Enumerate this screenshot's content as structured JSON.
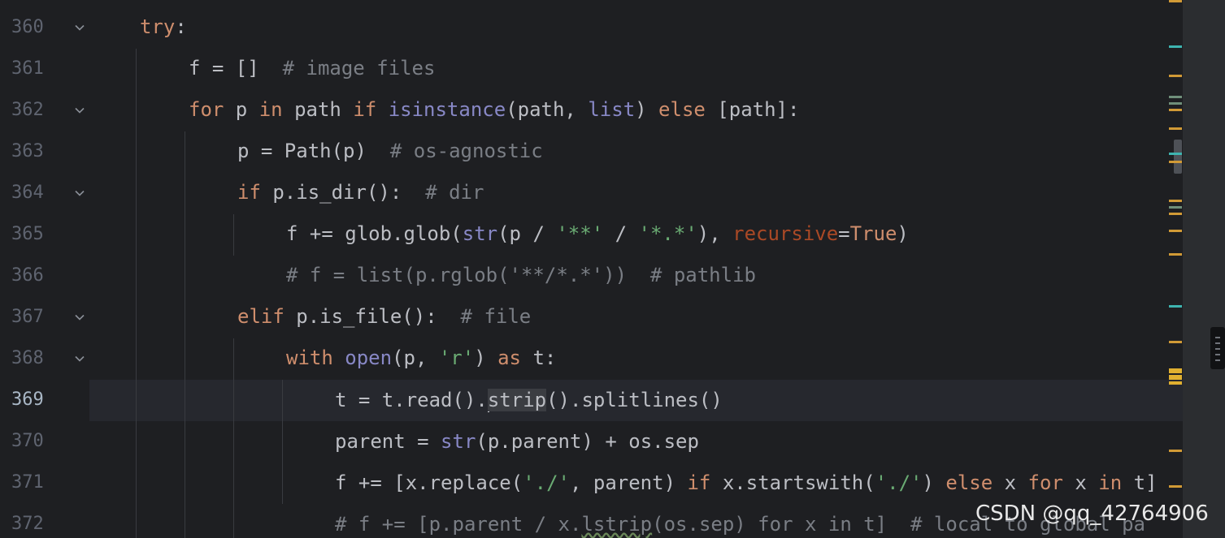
{
  "editor": {
    "current_line_number": 369,
    "lines": [
      {
        "number": "360",
        "foldable": true
      },
      {
        "number": "361",
        "foldable": false
      },
      {
        "number": "362",
        "foldable": true
      },
      {
        "number": "363",
        "foldable": false
      },
      {
        "number": "364",
        "foldable": true
      },
      {
        "number": "365",
        "foldable": false
      },
      {
        "number": "366",
        "foldable": false
      },
      {
        "number": "367",
        "foldable": true
      },
      {
        "number": "368",
        "foldable": true
      },
      {
        "number": "369",
        "foldable": false
      },
      {
        "number": "370",
        "foldable": false
      },
      {
        "number": "371",
        "foldable": false
      },
      {
        "number": "372",
        "foldable": false
      }
    ],
    "code": {
      "l360": {
        "kw_try": "try",
        "colon": ":"
      },
      "l361": {
        "text": "f = []  ",
        "comment": "# image files"
      },
      "l362": {
        "kw_for": "for",
        "p1": " p ",
        "kw_in": "in",
        "p2": " path ",
        "kw_if": "if",
        "p3": " ",
        "bi_isinstance": "isinstance",
        "p4": "(path, ",
        "bi_list": "list",
        "p5": ") ",
        "kw_else": "else",
        "p6": " [path]:"
      },
      "l363": {
        "text": "p = Path(p)  ",
        "comment": "# os-agnostic"
      },
      "l364": {
        "kw_if": "if",
        "text": " p.is_dir():  ",
        "comment": "# dir"
      },
      "l365": {
        "p1": "f += glob.glob(",
        "bi_str": "str",
        "p2": "(p / ",
        "s1": "'**'",
        "p3": " / ",
        "s2": "'*.*'",
        "p4": "), ",
        "param": "recursive",
        "p5": "=",
        "kw_true": "True",
        "p6": ")"
      },
      "l366": {
        "comment": "# f = list(p.rglob('**/*.*'))  # pathlib"
      },
      "l367": {
        "kw_elif": "elif",
        "text": " p.is_file():  ",
        "comment": "# file"
      },
      "l368": {
        "kw_with": "with",
        "p1": " ",
        "bi_open": "open",
        "p2": "(p, ",
        "s1": "'r'",
        "p3": ") ",
        "kw_as": "as",
        "p4": " t:"
      },
      "l369": {
        "p1": "t = t.read().",
        "hl": "strip",
        "p2": "().splitlines()"
      },
      "l370": {
        "p1": "parent = ",
        "bi_str": "str",
        "p2": "(p.parent) + os.sep"
      },
      "l371": {
        "p1": "f += [x.replace(",
        "s1": "'./'",
        "p2": ", parent) ",
        "kw_if": "if",
        "p3": " x.startswith(",
        "s2": "'./'",
        "p4": ") ",
        "kw_else": "else",
        "p5": " x ",
        "kw_for": "for",
        "p6": " x ",
        "kw_in": "in",
        "p7": " t]"
      },
      "l372": {
        "c1": "# f += [p.parent / x.",
        "wavy": "lstrip",
        "c2": "(os.sep) for x in t]  # local to global pa"
      }
    }
  },
  "colors": {
    "background": "#1e1f22",
    "keyword": "#cf8e6d",
    "builtin": "#8888c6",
    "string": "#6aab73",
    "comment": "#7a7e85",
    "parameter": "#aa4926",
    "marker_yellow": "#d19a36",
    "marker_teal": "#3eb4b0"
  },
  "icons": {
    "fold": "chevron-down-icon"
  },
  "watermark": "CSDN @qq_42764906"
}
